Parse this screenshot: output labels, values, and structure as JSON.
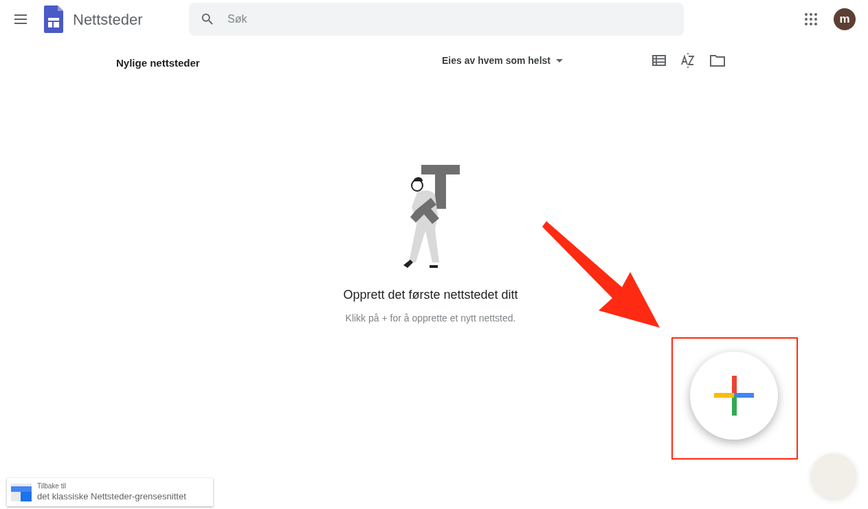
{
  "header": {
    "title": "Nettsteder",
    "search": {
      "placeholder": "Søk"
    },
    "avatar": "m"
  },
  "toolbar": {
    "title": "Nylige nettsteder",
    "owner_filter": "Eies av hvem som helst"
  },
  "empty_state": {
    "title": "Opprett det første nettstedet ditt",
    "subtitle": "Klikk på + for å opprette et nytt nettsted."
  },
  "classic_link": {
    "caption": "Tilbake til",
    "label": "det klassiske Nettsteder-grensesnittet"
  }
}
